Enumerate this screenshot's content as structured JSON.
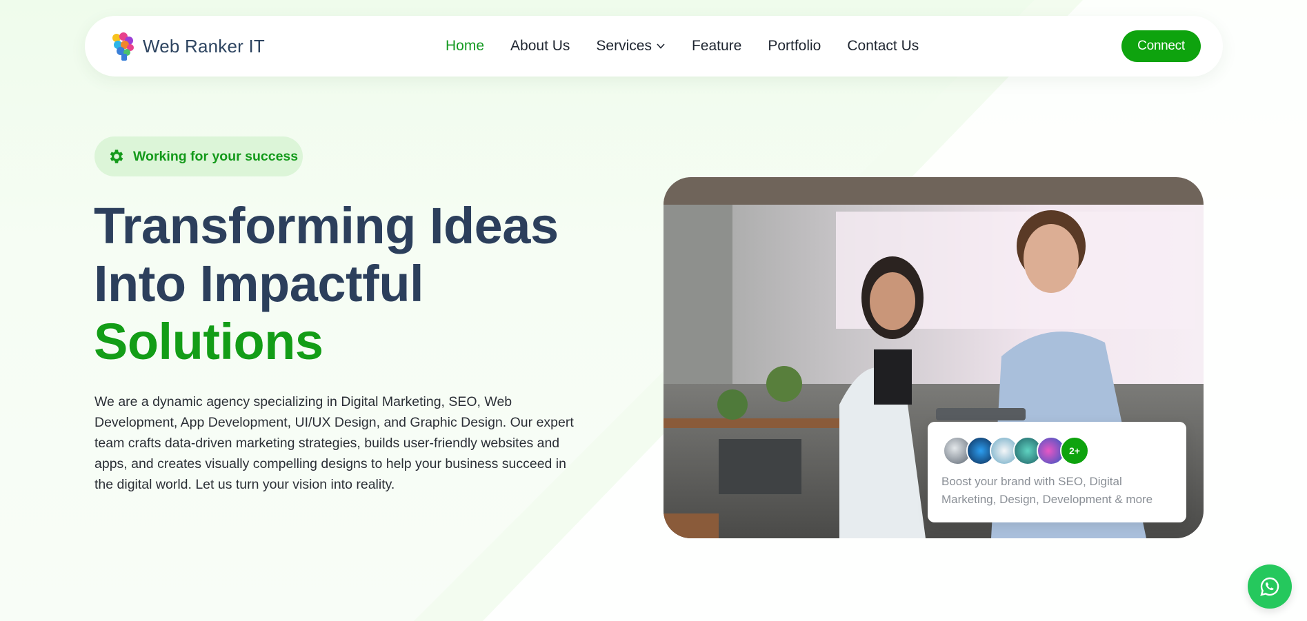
{
  "brand": {
    "name": "Web Ranker IT"
  },
  "nav": {
    "items": [
      {
        "label": "Home",
        "active": true
      },
      {
        "label": "About Us"
      },
      {
        "label": "Services",
        "has_dropdown": true
      },
      {
        "label": "Feature"
      },
      {
        "label": "Portfolio"
      },
      {
        "label": "Contact Us"
      }
    ],
    "cta": "Connect"
  },
  "hero": {
    "badge": "Working for your success",
    "headline_line1": "Transforming Ideas",
    "headline_line2": "Into Impactful",
    "headline_accent": "Solutions",
    "description": "We are a dynamic agency specializing in Digital Marketing, SEO, Web Development, App Development, UI/UX Design, and Graphic Design. Our expert team crafts data-driven marketing strategies, builds user-friendly websites and apps, and creates visually compelling designs to help your business succeed in the digital world. Let us turn your vision into reality."
  },
  "card": {
    "more_badge": "2+",
    "text": "Boost your brand with SEO, Digital Marketing, Design, Development & more"
  },
  "icons": [
    "brain-logo-icon",
    "gear-icon",
    "chevron-down-icon",
    "whatsapp-icon"
  ],
  "colors": {
    "accent": "#0ea30e",
    "heading": "#2c3f5c",
    "whatsapp": "#25c85d",
    "background": "#f6fdf4"
  }
}
